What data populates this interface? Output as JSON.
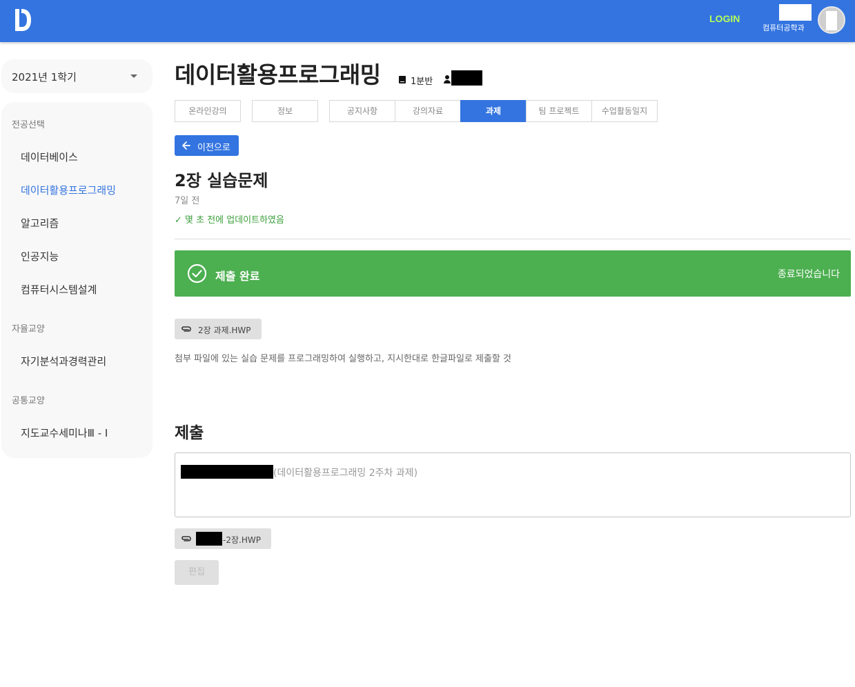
{
  "header": {
    "logo": "D",
    "login_label": "LOGIN",
    "department": "컴퓨터공학과",
    "colors": {
      "bar": "#3374e0",
      "login": "#b6ff5a"
    }
  },
  "sidebar": {
    "semester": "2021년 1학기",
    "groups": [
      {
        "category": "전공선택",
        "items": [
          "데이터베이스",
          "데이터활용프로그래밍",
          "알고리즘",
          "인공지능",
          "컴퓨터시스템설계"
        ]
      },
      {
        "category": "자율교양",
        "items": [
          "자기분석과경력관리"
        ]
      },
      {
        "category": "공통교양",
        "items": [
          "지도교수세미나Ⅲ - Ⅰ"
        ]
      }
    ],
    "active_item": "데이터활용프로그래밍"
  },
  "course": {
    "title": "데이터활용프로그래밍",
    "class": "1분반"
  },
  "tabs": [
    "온라인강의",
    "정보",
    "공지사항",
    "강의자료",
    "과제",
    "팀 프로젝트",
    "수업활동일지"
  ],
  "active_tab": "과제",
  "back_label": "이전으로",
  "assignment": {
    "title": "2장 실습문제",
    "posted": "7일 전",
    "updated": "✓ 몇 초 전에 업데이트하였음",
    "status": "제출 완료",
    "status_right": "종료되었습니다",
    "status_color": "#4caf50",
    "attachment": "2장 과제.HWP",
    "description": "첨부 파일에 있는 실습 문제를 프로그래밍하여 실행하고, 지시한대로 한글파일로 제출할 것"
  },
  "submission": {
    "heading": "제출",
    "text": "(데이터활용프로그래밍 2주차 과제)",
    "file_suffix": "-2장.HWP",
    "edit_label": "편집"
  }
}
